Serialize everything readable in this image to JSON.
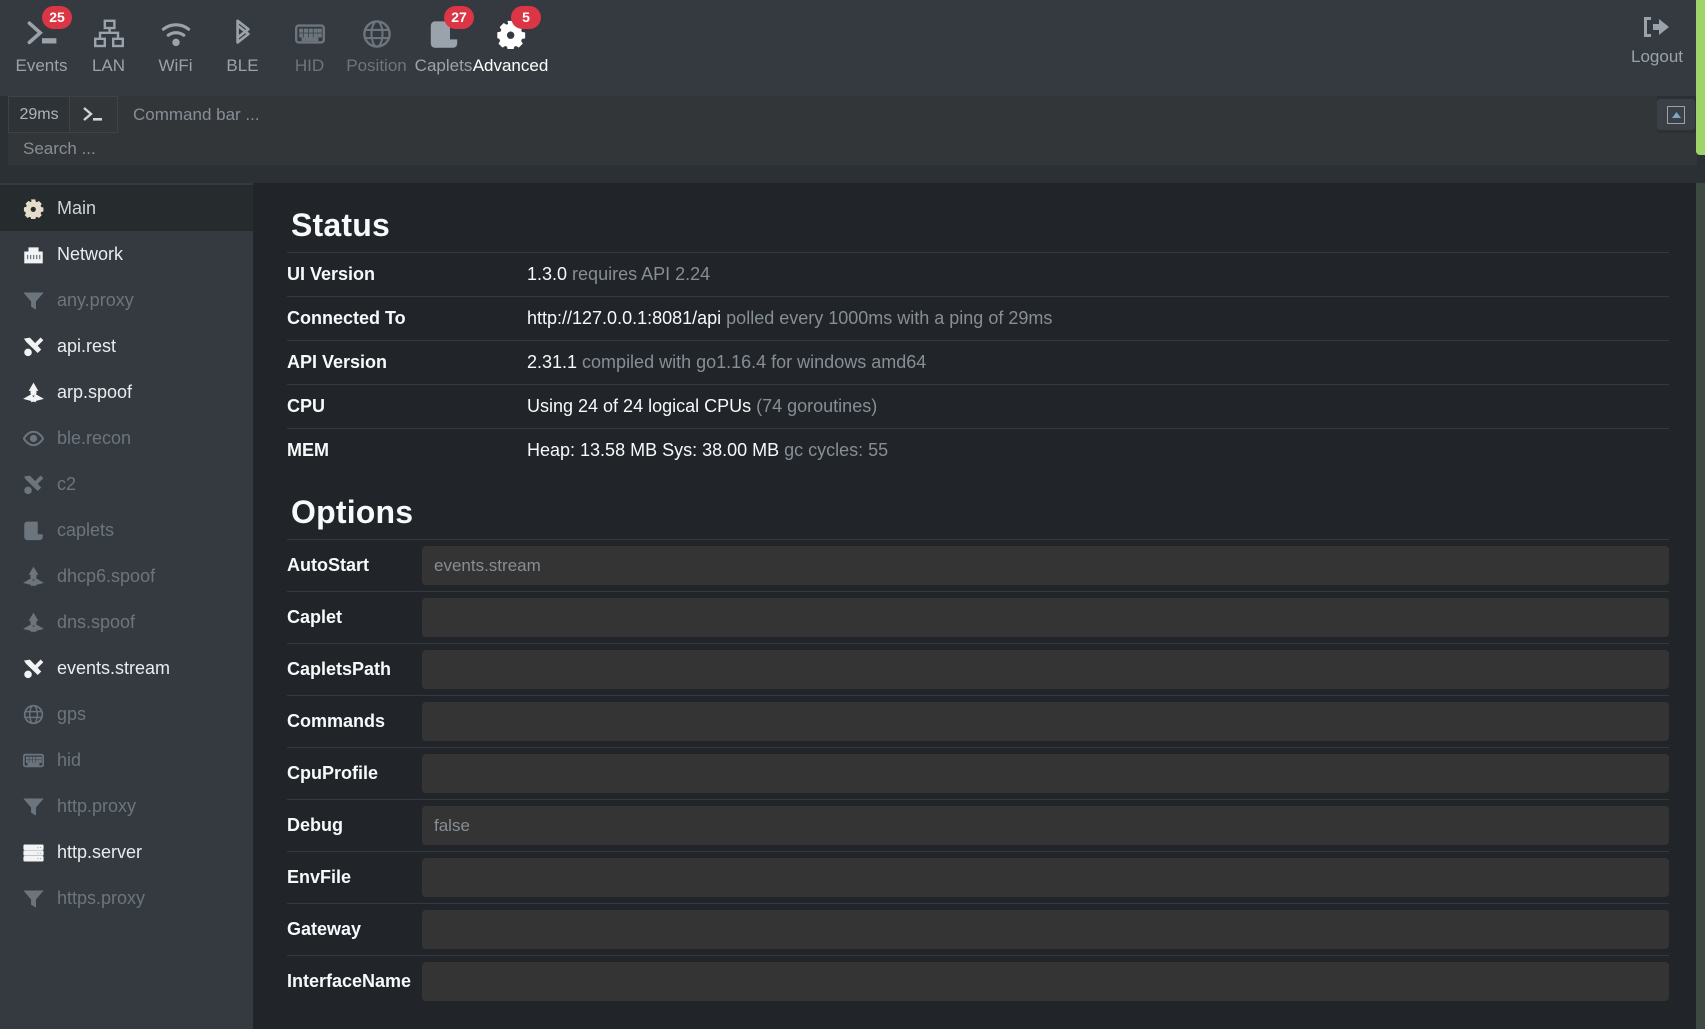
{
  "topnav": {
    "items": [
      {
        "label": "Events",
        "icon": "terminal-prompt-icon",
        "badge": "25",
        "state": "enabled"
      },
      {
        "label": "LAN",
        "icon": "network-lan-icon",
        "badge": "",
        "state": "enabled"
      },
      {
        "label": "WiFi",
        "icon": "wifi-icon",
        "badge": "",
        "state": "enabled"
      },
      {
        "label": "BLE",
        "icon": "bluetooth-icon",
        "badge": "",
        "state": "enabled"
      },
      {
        "label": "HID",
        "icon": "keyboard-icon",
        "badge": "",
        "state": "disabled"
      },
      {
        "label": "Position",
        "icon": "globe-icon",
        "badge": "",
        "state": "disabled"
      },
      {
        "label": "Caplets",
        "icon": "scroll-icon",
        "badge": "27",
        "state": "enabled"
      },
      {
        "label": "Advanced",
        "icon": "gears-icon",
        "badge": "5",
        "state": "active"
      }
    ],
    "logout": {
      "label": "Logout",
      "icon": "logout-icon"
    },
    "badge_color": "#dc3545",
    "accent_strip_color": "#a0d468"
  },
  "commandbar": {
    "ping": "29ms",
    "prompt_icon": "terminal-prompt-icon",
    "placeholder": "Command bar ...",
    "value": "",
    "toggle_icon": "collapse-up-icon"
  },
  "search": {
    "placeholder": "Search ...",
    "value": ""
  },
  "sidebar": {
    "items": [
      {
        "label": "Main",
        "icon": "gear-icon",
        "state": "selected"
      },
      {
        "label": "Network",
        "icon": "ethernet-icon",
        "state": "on"
      },
      {
        "label": "any.proxy",
        "icon": "filter-icon",
        "state": "off"
      },
      {
        "label": "api.rest",
        "icon": "tools-icon",
        "state": "on"
      },
      {
        "label": "arp.spoof",
        "icon": "hazard-icon",
        "state": "on"
      },
      {
        "label": "ble.recon",
        "icon": "eye-icon",
        "state": "off"
      },
      {
        "label": "c2",
        "icon": "tools-icon",
        "state": "off"
      },
      {
        "label": "caplets",
        "icon": "scroll-icon",
        "state": "off"
      },
      {
        "label": "dhcp6.spoof",
        "icon": "hazard-icon",
        "state": "off"
      },
      {
        "label": "dns.spoof",
        "icon": "hazard-icon",
        "state": "off"
      },
      {
        "label": "events.stream",
        "icon": "tools-icon",
        "state": "on"
      },
      {
        "label": "gps",
        "icon": "globe-icon",
        "state": "off"
      },
      {
        "label": "hid",
        "icon": "keyboard-icon",
        "state": "off"
      },
      {
        "label": "http.proxy",
        "icon": "filter-icon",
        "state": "off"
      },
      {
        "label": "http.server",
        "icon": "server-icon",
        "state": "on"
      },
      {
        "label": "https.proxy",
        "icon": "filter-icon",
        "state": "off"
      }
    ]
  },
  "main": {
    "status": {
      "title": "Status",
      "rows": [
        {
          "key": "UI Version",
          "value": "1.3.0",
          "note": "requires API 2.24"
        },
        {
          "key": "Connected To",
          "value": "http://127.0.0.1:8081/api",
          "note": "polled every 1000ms with a ping of 29ms"
        },
        {
          "key": "API Version",
          "value": "2.31.1",
          "note": "compiled with go1.16.4 for windows amd64"
        },
        {
          "key": "CPU",
          "value": "Using 24 of 24 logical CPUs",
          "note": "(74 goroutines)"
        },
        {
          "key": "MEM",
          "value": "Heap: 13.58 MB Sys: 38.00 MB",
          "note": "gc cycles: 55"
        }
      ]
    },
    "options": {
      "title": "Options",
      "rows": [
        {
          "key": "AutoStart",
          "value": "events.stream"
        },
        {
          "key": "Caplet",
          "value": ""
        },
        {
          "key": "CapletsPath",
          "value": ""
        },
        {
          "key": "Commands",
          "value": ""
        },
        {
          "key": "CpuProfile",
          "value": ""
        },
        {
          "key": "Debug",
          "value": "false"
        },
        {
          "key": "EnvFile",
          "value": ""
        },
        {
          "key": "Gateway",
          "value": ""
        },
        {
          "key": "InterfaceName",
          "value": ""
        }
      ]
    }
  }
}
